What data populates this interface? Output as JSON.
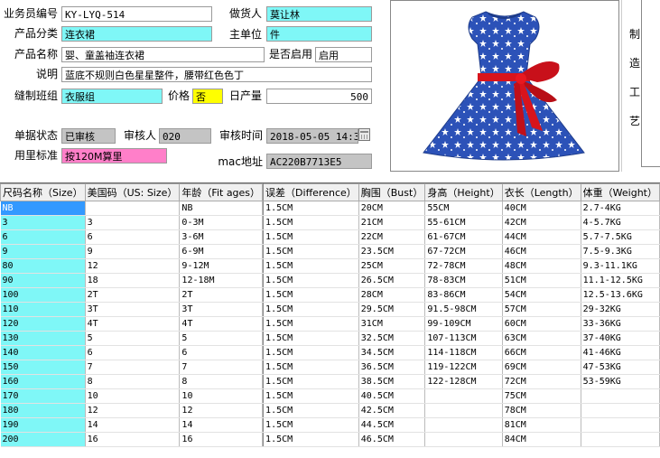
{
  "form": {
    "salesman_no": {
      "label": "业务员编号",
      "value": "KY-LYQ-514"
    },
    "merchandiser": {
      "label": "做货人",
      "value": "莫让林"
    },
    "category": {
      "label": "产品分类",
      "value": "连衣裙"
    },
    "unit": {
      "label": "主单位",
      "value": "件"
    },
    "product_name": {
      "label": "产品名称",
      "value": "婴、童盖袖连衣裙"
    },
    "enabled": {
      "label": "是否启用",
      "value": "启用"
    },
    "description": {
      "label": "说明",
      "value": "蓝底不规则白色星星整件，腰带红色色丁"
    },
    "sewing_group": {
      "label": "缝制班组",
      "value": "衣服组"
    },
    "price": {
      "label": "价格",
      "value": "否"
    },
    "daily_output": {
      "label": "日产量",
      "value": "500"
    },
    "doc_status": {
      "label": "单据状态",
      "value": "已审核"
    },
    "reviewer": {
      "label": "审核人",
      "value": "020"
    },
    "review_time": {
      "label": "审核时间",
      "value": "2018-05-05  14:3"
    },
    "fabric_standard": {
      "label": "用里标准",
      "value": "按120M算里"
    },
    "mac": {
      "label": "mac地址",
      "value": "AC220B7713E5"
    }
  },
  "side_panel": {
    "chars": [
      "制",
      "造",
      "工",
      "艺"
    ]
  },
  "colors": {
    "dress_blue": "#2c52b8",
    "sash_red": "#d8141c",
    "field_cyan": "#7ff7f7",
    "selected": "#3399ff"
  },
  "table": {
    "headers": [
      "尺码名称（Size）",
      "美国码（US: Size）",
      "年龄（Fit ages）",
      "",
      "误差（Difference）",
      "胸围（Bust）",
      "身高（Height）",
      "衣长（Length）",
      "体重（Weight）"
    ],
    "rows": [
      [
        "NB",
        "",
        "NB",
        "",
        "1.5CM",
        "20CM",
        "55CM",
        "40CM",
        "2.7-4KG"
      ],
      [
        "3",
        "3",
        "0-3M",
        "",
        "1.5CM",
        "21CM",
        "55-61CM",
        "42CM",
        "4-5.7KG"
      ],
      [
        "6",
        "6",
        "3-6M",
        "",
        "1.5CM",
        "22CM",
        "61-67CM",
        "44CM",
        "5.7-7.5KG"
      ],
      [
        "9",
        "9",
        "6-9M",
        "",
        "1.5CM",
        "23.5CM",
        "67-72CM",
        "46CM",
        "7.5-9.3KG"
      ],
      [
        "80",
        "12",
        "9-12M",
        "",
        "1.5CM",
        "25CM",
        "72-78CM",
        "48CM",
        "9.3-11.1KG"
      ],
      [
        "90",
        "18",
        "12-18M",
        "",
        "1.5CM",
        "26.5CM",
        "78-83CM",
        "51CM",
        "11.1-12.5KG"
      ],
      [
        "100",
        "2T",
        "2T",
        "",
        "1.5CM",
        "28CM",
        "83-86CM",
        "54CM",
        "12.5-13.6KG"
      ],
      [
        "110",
        "3T",
        "3T",
        "",
        "1.5CM",
        "29.5CM",
        "91.5-98CM",
        "57CM",
        "29-32KG"
      ],
      [
        "120",
        "4T",
        "4T",
        "",
        "1.5CM",
        "31CM",
        "99-109CM",
        "60CM",
        "33-36KG"
      ],
      [
        "130",
        "5",
        "5",
        "",
        "1.5CM",
        "32.5CM",
        "107-113CM",
        "63CM",
        "37-40KG"
      ],
      [
        "140",
        "6",
        "6",
        "",
        "1.5CM",
        "34.5CM",
        "114-118CM",
        "66CM",
        "41-46KG"
      ],
      [
        "150",
        "7",
        "7",
        "",
        "1.5CM",
        "36.5CM",
        "119-122CM",
        "69CM",
        "47-53KG"
      ],
      [
        "160",
        "8",
        "8",
        "",
        "1.5CM",
        "38.5CM",
        "122-128CM",
        "72CM",
        "53-59KG"
      ],
      [
        "170",
        "10",
        "10",
        "",
        "1.5CM",
        "40.5CM",
        "",
        "75CM",
        ""
      ],
      [
        "180",
        "12",
        "12",
        "",
        "1.5CM",
        "42.5CM",
        "",
        "78CM",
        ""
      ],
      [
        "190",
        "14",
        "14",
        "",
        "1.5CM",
        "44.5CM",
        "",
        "81CM",
        ""
      ],
      [
        "200",
        "16",
        "16",
        "",
        "1.5CM",
        "46.5CM",
        "",
        "84CM",
        ""
      ]
    ]
  }
}
